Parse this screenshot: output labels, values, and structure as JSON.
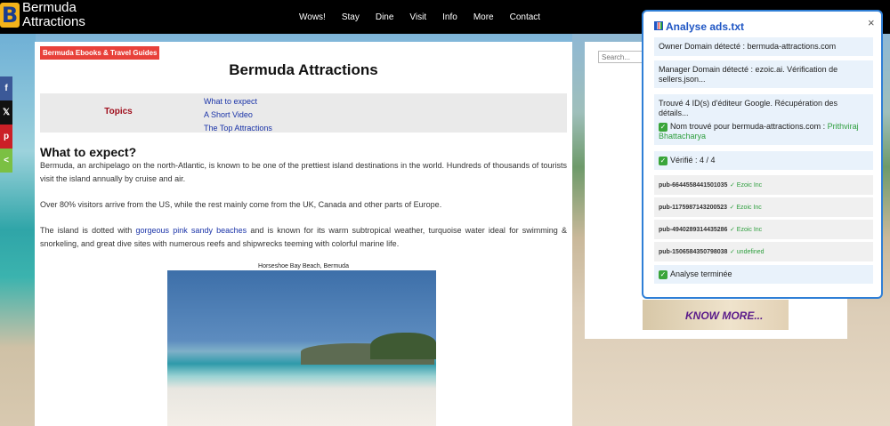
{
  "site": {
    "logo_letter": "B",
    "logo_line1": "Bermuda",
    "logo_line2": "Attractions"
  },
  "nav": [
    "Wows!",
    "Stay",
    "Dine",
    "Visit",
    "Info",
    "More",
    "Contact"
  ],
  "share": [
    "f",
    "𝕏",
    "p",
    "<"
  ],
  "article": {
    "ebook_badge": "Bermuda Ebooks & Travel Guides",
    "title": "Bermuda Attractions",
    "topics_label": "Topics",
    "topics": [
      "What to expect",
      "A Short Video",
      "The Top Attractions"
    ],
    "section_heading": "What to expect?",
    "p1": "Bermuda, an archipelago on the north-Atlantic, is known to be one of the prettiest island destinations in the world. Hundreds of thousands of tourists visit the island annually by cruise and air.",
    "p2": "Over 80% visitors arrive from the US, while the rest mainly come from the UK, Canada and other parts of Europe.",
    "p3_before": "The island is dotted with ",
    "p3_link": "gorgeous pink sandy beaches",
    "p3_after": " and is known for its warm subtropical weather, turquoise water ideal for swimming & snorkeling, and great dive sites with numerous reefs and shipwrecks teeming with colorful marine life.",
    "photo_caption": "Horseshoe Bay Beach, Bermuda"
  },
  "sidebar": {
    "search_placeholder": "Search...",
    "ad_text": "KNOW MORE..."
  },
  "popup": {
    "title": "Analyse ads.txt",
    "close": "×",
    "owner": "Owner Domain détecté : bermuda-attractions.com",
    "manager": "Manager Domain détecté : ezoic.ai. Vérification de sellers.json...",
    "found": "Trouvé 4 ID(s) d'éditeur Google. Récupération des détails...",
    "name_prefix": "Nom trouvé pour bermuda-attractions.com : ",
    "name_value": "Prithviraj Bhattacharya",
    "verified": "Vérifié : 4 / 4",
    "pubs": [
      {
        "id": "pub-6644558441501035",
        "status": "✓ Ezoic Inc"
      },
      {
        "id": "pub-1175987143200523",
        "status": "✓ Ezoic Inc"
      },
      {
        "id": "pub-4940289314435286",
        "status": "✓ Ezoic Inc"
      },
      {
        "id": "pub-1506584350798038",
        "status": "✓ undefined"
      }
    ],
    "done": "Analyse terminée"
  },
  "colors": {
    "nav_bg": "#000000",
    "badge_red": "#e8413a",
    "topics_red": "#a0101e",
    "link_blue": "#1a33a8",
    "popup_border": "#2f7fd6",
    "success_green": "#2e9e3e"
  }
}
